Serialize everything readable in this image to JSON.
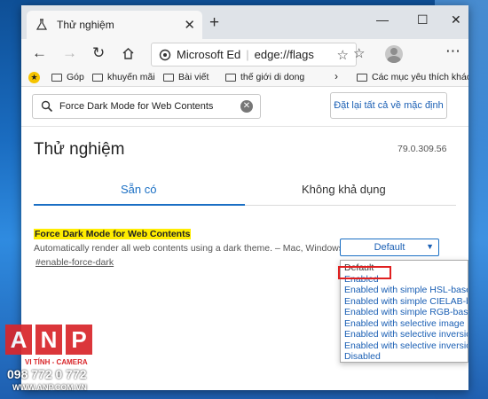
{
  "browser": {
    "tab_title": "Thử nghiệm",
    "new_tab_glyph": "+",
    "close_glyph": "✕",
    "window_controls": {
      "minimize": "—",
      "maximize": "☐",
      "close": "✕"
    }
  },
  "navbar": {
    "address_site": "Microsoft Ed",
    "address_url": "edge://flags"
  },
  "bookmarks": {
    "items": [
      "Góp",
      "khuyến mãi",
      "Bài viết",
      "thế giới di dong"
    ],
    "overflow": "›",
    "other": "Các mục yêu thích khác"
  },
  "toolbar": {
    "search_value": "Force Dark Mode for Web Contents",
    "reset_label": "Đặt lại tất cả về mặc định"
  },
  "page": {
    "title": "Thử nghiệm",
    "version": "79.0.309.56",
    "tabs": [
      "Sẵn có",
      "Không khả dụng"
    ]
  },
  "flag": {
    "title": "Force Dark Mode for Web Contents",
    "description": "Automatically render all web contents using a dark theme. – Mac, Windows",
    "link": "#enable-force-dark",
    "selected": "Default",
    "options": [
      "Default",
      "Enabled",
      "Enabled with simple HSL-based inversion",
      "Enabled with simple CIELAB-based inversion",
      "Enabled with simple RGB-based inversion",
      "Enabled with selective image inversion",
      "Enabled with selective inversion of non-image elements",
      "Enabled with selective inversion of everything",
      "Disabled"
    ]
  },
  "watermark": {
    "letters": [
      "A",
      "N",
      "P"
    ],
    "line1": "VI TÍNH - CAMERA",
    "line2": "098 772 0 772",
    "line3": "WWW.ANP.COM.VN"
  },
  "colors": {
    "accent": "#1a6fc4",
    "highlight": "#ffed00",
    "annotation": "#e02020",
    "watermark": "#d9262a"
  }
}
